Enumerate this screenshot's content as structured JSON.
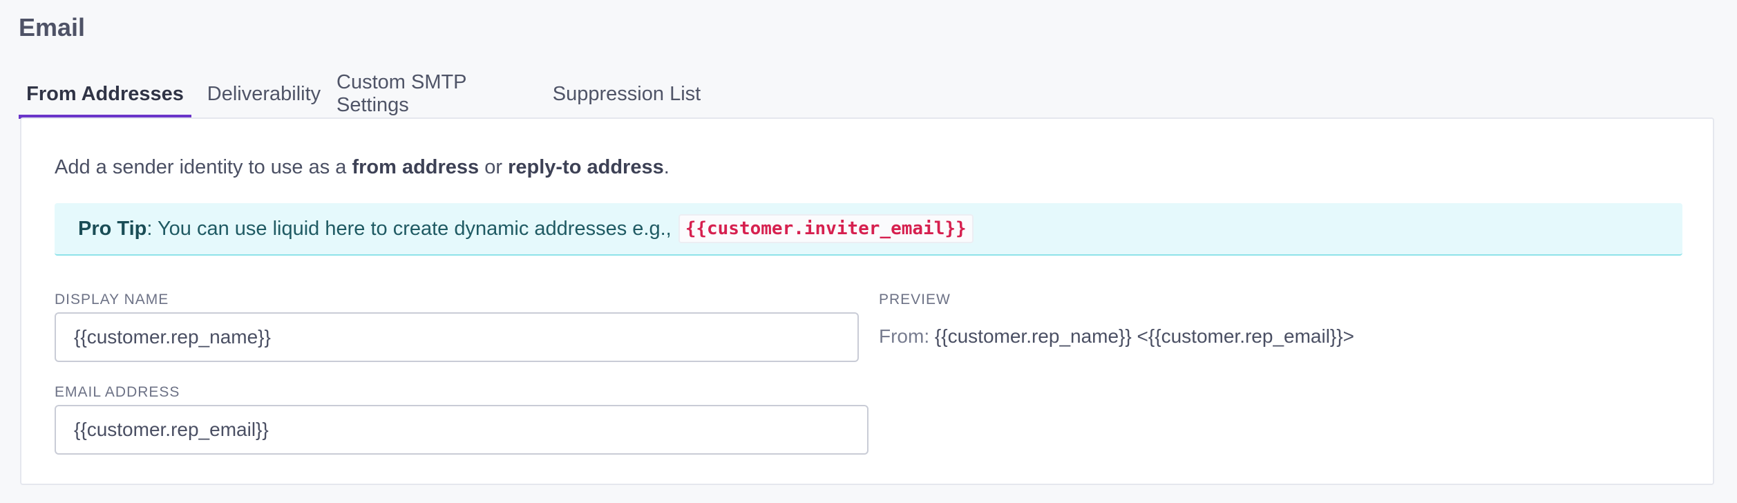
{
  "page": {
    "title": "Email"
  },
  "tabs": [
    {
      "label": "From Addresses",
      "active": true
    },
    {
      "label": "Deliverability",
      "active": false
    },
    {
      "label": "Custom SMTP Settings",
      "active": false
    },
    {
      "label": "Suppression List",
      "active": false
    }
  ],
  "intro": {
    "text_before": "Add a sender identity to use as a ",
    "bold_1": "from address",
    "text_middle": " or ",
    "bold_2": "reply-to address",
    "text_after": "."
  },
  "tip": {
    "bold": "Pro Tip",
    "text": ": You can use liquid here to create dynamic addresses e.g., ",
    "code": "{{customer.inviter_email}}"
  },
  "form": {
    "display_name_label": "DISPLAY NAME",
    "display_name_value": "{{customer.rep_name}}",
    "email_label": "EMAIL ADDRESS",
    "email_value": "{{customer.rep_email}}"
  },
  "preview": {
    "label": "PREVIEW",
    "prefix": "From:",
    "value": "{{customer.rep_name}} <{{customer.rep_email}}>"
  },
  "colors": {
    "accent": "#6a35c9",
    "tip_background": "#e5f9fc",
    "code_text": "#d6204f"
  }
}
